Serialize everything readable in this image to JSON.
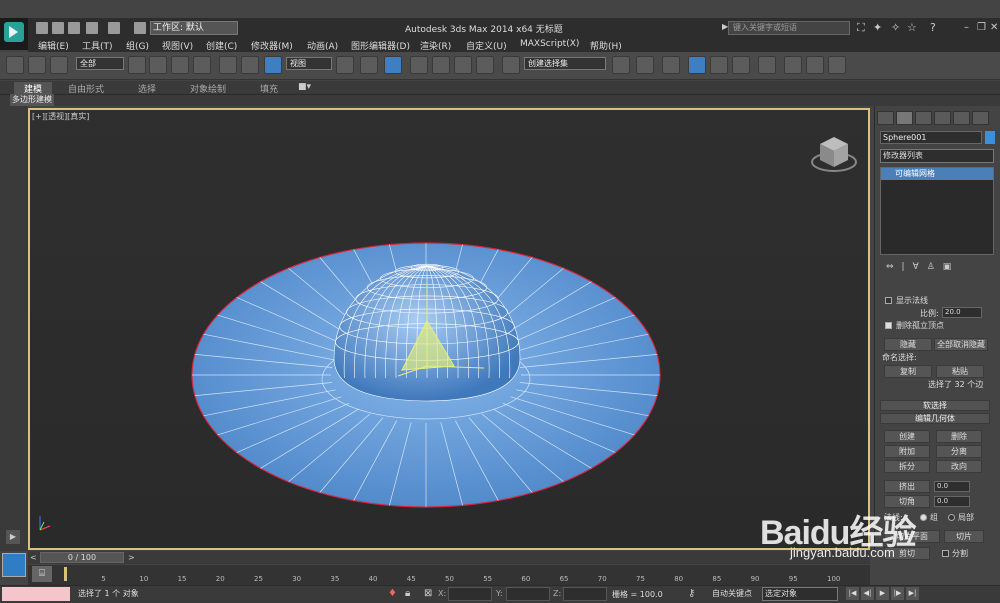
{
  "window": {
    "title": "Autodesk 3ds Max  2014 x64    无标题",
    "workspace_label": "工作区: 默认",
    "search_placeholder": "键入关键字或短语",
    "minimize": "–",
    "restore": "❐",
    "close": "✕"
  },
  "menu": [
    "编辑(E)",
    "工具(T)",
    "组(G)",
    "视图(V)",
    "创建(C)",
    "修改器(M)",
    "动画(A)",
    "图形编辑器(D)",
    "渲染(R)",
    "自定义(U)",
    "MAXScript(X)",
    "帮助(H)"
  ],
  "toolbar": {
    "filter_value": "全部",
    "refcoord_value": "视图",
    "named_selection_value": "创建选择集"
  },
  "ribbon": {
    "tabs": [
      "建模",
      "自由形式",
      "选择",
      "对象绘制",
      "填充"
    ],
    "sub_tab": "多边形建模"
  },
  "viewport": {
    "label": "[+][透视][真实]"
  },
  "command_panel": {
    "object_name": "Sphere001",
    "modifier_list": "修改器列表",
    "stack_item": "可编辑网格",
    "show_normals": "显示法线",
    "scale_label": "比例:",
    "scale_value": "20.0",
    "delete_isolated": "删除孤立顶点",
    "hide_btn": "隐藏",
    "unhide_all_btn": "全部取消隐藏",
    "named_selection_label": "命名选择:",
    "copy_btn": "复制",
    "paste_btn": "粘贴",
    "selected_info": "选择了 32 个边",
    "soft_selection": "软选择",
    "edit_geometry": "编辑几何体",
    "create_btn": "创建",
    "delete_btn": "删除",
    "attach_btn": "附加",
    "detach_btn": "分离",
    "divide_btn": "拆分",
    "turn_btn": "改向",
    "extrude_label": "挤出",
    "extrude_value": "0.0",
    "chamfer_label": "切角",
    "chamfer_value": "0.0",
    "normal_label": "法线:",
    "group_label": "组",
    "local_label": "局部",
    "slice_plane_btn": "切片平面",
    "slice_btn": "切片",
    "cut_btn": "剪切",
    "split_label": "分割"
  },
  "timeline": {
    "frame_display": "0 / 100",
    "ticks": [
      "0",
      "5",
      "10",
      "15",
      "20",
      "25",
      "30",
      "35",
      "40",
      "45",
      "50",
      "55",
      "60",
      "65",
      "70",
      "75",
      "80",
      "85",
      "90",
      "95",
      "100"
    ]
  },
  "status": {
    "message": "选择了 1 个 对象",
    "x_label": "X:",
    "y_label": "Y:",
    "z_label": "Z:",
    "grid": "栅格 = 100.0",
    "auto_key": "自动关键点",
    "selected_object": "选定对象"
  },
  "watermark": {
    "brand": "Baidu经验",
    "url": "jingyan.baidu.com"
  },
  "colors": {
    "mesh_fill": "#5d95d6",
    "mesh_edge_selected": "#d7263d",
    "viewport_border": "#d9c27a",
    "active_blue": "#3f7fbf"
  }
}
